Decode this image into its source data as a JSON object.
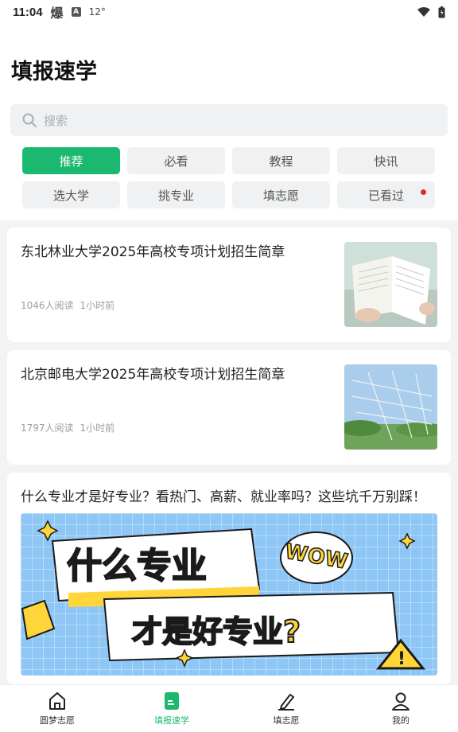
{
  "status_bar": {
    "time": "11:04",
    "icons": [
      "app-icon",
      "a-icon",
      "temperature-icon",
      "wifi-icon",
      "battery-icon"
    ],
    "temp": "12°"
  },
  "page": {
    "title": "填报速学"
  },
  "search": {
    "placeholder": "搜索"
  },
  "categories": [
    {
      "label": "推荐",
      "active": true
    },
    {
      "label": "必看"
    },
    {
      "label": "教程"
    },
    {
      "label": "快讯"
    },
    {
      "label": "选大学"
    },
    {
      "label": "挑专业"
    },
    {
      "label": "填志愿"
    },
    {
      "label": "已看过",
      "badge": true
    }
  ],
  "articles": [
    {
      "title": "东北林业大学2025年高校专项计划招生简章",
      "reads": "1046人阅读",
      "time": "1小时前",
      "thumb": "book-photo"
    },
    {
      "title": "北京邮电大学2025年高校专项计划招生简章",
      "reads": "1797人阅读",
      "time": "1小时前",
      "thumb": "net-photo"
    },
    {
      "title": "什么专业才是好专业？看热门、高薪、就业率吗？这些坑千万别踩！",
      "banner": {
        "line1": "什么专业",
        "line2": "才是好专业?",
        "sticker": "WOW"
      }
    }
  ],
  "tabbar": [
    {
      "label": "圆梦志愿",
      "icon": "home-icon"
    },
    {
      "label": "填报速学",
      "icon": "document-icon",
      "active": true
    },
    {
      "label": "填志愿",
      "icon": "pen-icon"
    },
    {
      "label": "我的",
      "icon": "user-icon"
    }
  ],
  "colors": {
    "accent": "#1bb970",
    "badge": "#e02b2b"
  }
}
